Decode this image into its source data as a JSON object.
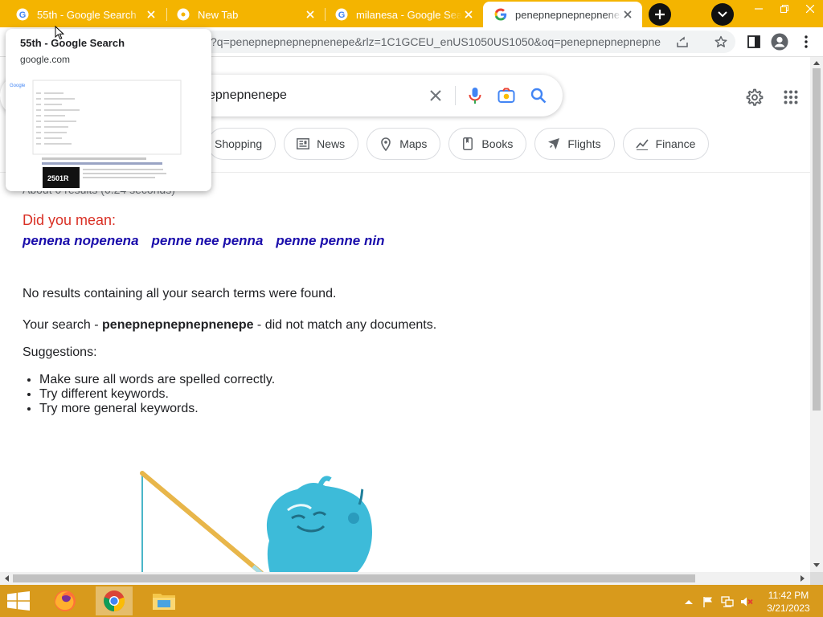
{
  "browser": {
    "tabs": [
      {
        "title": "55th - Google Search",
        "icon": "google-icon"
      },
      {
        "title": "New Tab",
        "icon": "chrome-icon"
      },
      {
        "title": "milanesa - Google Search",
        "icon": "google-icon"
      },
      {
        "title": "penepnepnepnepnenepe",
        "icon": "google-icon",
        "active": true
      }
    ],
    "url": "?q=penepnepnepnepnenepe&rlz=1C1GCEU_enUS1050US1050&oq=penepnepnepnepnenepe...",
    "colors": {
      "tabstrip": "#f4b400",
      "taskbar": "#d89a1c"
    }
  },
  "hover_card": {
    "title": "55th - Google Search",
    "domain": "google.com"
  },
  "search": {
    "query_visible": "epnepnenepe",
    "chips": [
      "Shopping",
      "News",
      "Maps",
      "Books",
      "Flights",
      "Finance"
    ]
  },
  "results": {
    "stats_visible": "About 0 results (0.24 seconds)",
    "did_you_mean": "Did you mean:",
    "suggestions": [
      "penena nopenena",
      "penne nee penna",
      "penne penne nin"
    ],
    "no_results": "No results containing all your search terms were found.",
    "your_search_prefix": "Your search - ",
    "your_search_term": "penepnepnepnepnenepe",
    "your_search_suffix": " - did not match any documents.",
    "suggestions_heading": "Suggestions:",
    "tips": [
      "Make sure all words are spelled correctly.",
      "Try different keywords.",
      "Try more general keywords."
    ]
  },
  "taskbar": {
    "apps": [
      "firefox-icon",
      "chrome-icon",
      "file-explorer-icon"
    ],
    "time": "11:42 PM",
    "date": "3/21/2023"
  }
}
